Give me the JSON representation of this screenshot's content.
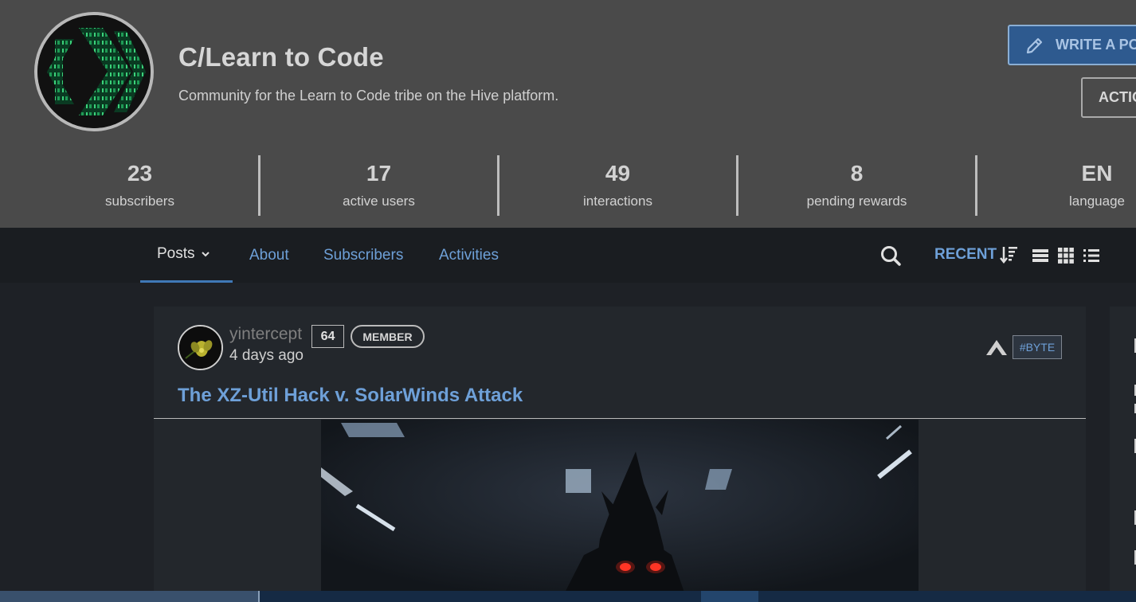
{
  "community": {
    "title": "C/Learn to Code",
    "description": "Community for the Learn to Code tribe on the Hive platform.",
    "write_button": "WRITE A PO",
    "actions_button": "ACTIO"
  },
  "stats": [
    {
      "value": "23",
      "label": "subscribers"
    },
    {
      "value": "17",
      "label": "active users"
    },
    {
      "value": "49",
      "label": "interactions"
    },
    {
      "value": "8",
      "label": "pending rewards"
    },
    {
      "value": "EN",
      "label": "language"
    }
  ],
  "nav": {
    "tabs": [
      {
        "label": "Posts"
      },
      {
        "label": "About"
      },
      {
        "label": "Subscribers"
      },
      {
        "label": "Activities"
      }
    ],
    "sort_label": "RECENT"
  },
  "post": {
    "author": "yintercept",
    "reputation": "64",
    "role": "MEMBER",
    "time": "4 days ago",
    "tag": "#BYTE",
    "title": "The XZ-Util Hack v. SolarWinds Attack"
  },
  "colors": {
    "header_bg": "#4a4a4a",
    "accent_blue": "#6ea0d8",
    "logo_green": "#2bb36a"
  },
  "icons": [
    "pencil-icon",
    "search-icon",
    "sort-icon",
    "list-view-icon",
    "grid-view-icon",
    "compact-view-icon",
    "chevron-down-icon",
    "app-logo-icon"
  ]
}
